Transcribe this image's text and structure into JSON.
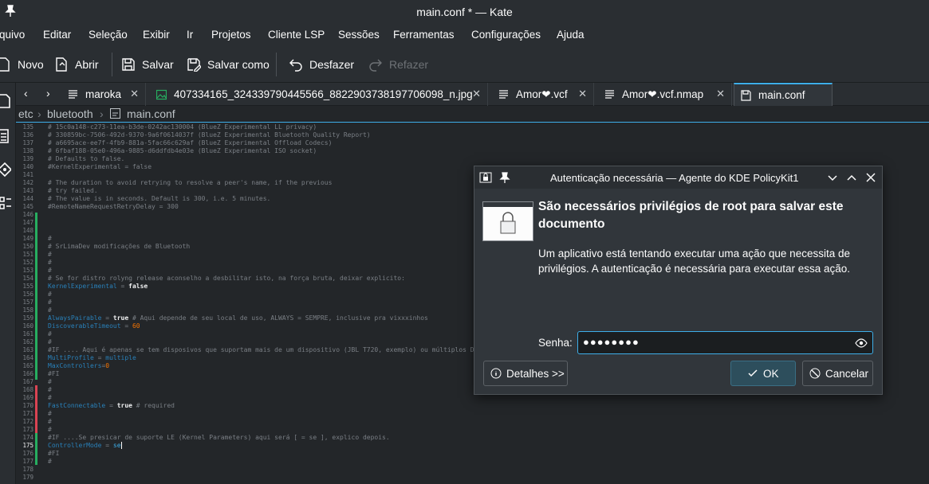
{
  "window": {
    "title": "main.conf * — Kate"
  },
  "menu": [
    "quivo",
    "Editar",
    "Seleção",
    "Exibir",
    "Ir",
    "Projetos",
    "Cliente LSP",
    "Sessões",
    "Ferramentas",
    "Configurações",
    "Ajuda"
  ],
  "toolbar": {
    "new_label": "Novo",
    "open_label": "Abrir",
    "save_label": "Salvar",
    "saveas_label": "Salvar como",
    "undo_label": "Desfazer",
    "redo_label": "Refazer"
  },
  "tabs": [
    {
      "label": "maroka"
    },
    {
      "label": "407334165_324339790445566_8822903738197706098_n.jpg"
    },
    {
      "label": "Amor❤.vcf"
    },
    {
      "label": "Amor❤.vcf.nmap"
    },
    {
      "label": "main.conf"
    }
  ],
  "breadcrumb": {
    "p1": "etc",
    "p2": "bluetooth",
    "p3": "main.conf"
  },
  "editor": {
    "line_numbers": [
      "135",
      "136",
      "137",
      "138",
      "139",
      "140",
      "141",
      "142",
      "143",
      "144",
      "145",
      "146",
      "147",
      "148",
      "149",
      "150",
      "151",
      "152",
      "153",
      "154",
      "155",
      "156",
      "157",
      "158",
      "159",
      "160",
      "161",
      "162",
      "163",
      "164",
      "165",
      "166",
      "167",
      "168",
      "169",
      "170",
      "171",
      "172",
      "173",
      "174",
      "175",
      "176",
      "177",
      "178",
      "179"
    ],
    "current_line": "175",
    "lines": {
      "l135": "# 15c0a148-c273-11ea-b3de-0242ac130004 (BlueZ Experimental LL privacy)",
      "l136": "# 330859bc-7506-492d-9370-9a6f0614037f (BlueZ Experimental Bluetooth Quality Report)",
      "l137": "# a6695ace-ee7f-4fb9-881a-5fac66c629af (BlueZ Experimental Offload Codecs)",
      "l138": "# 6fbaf188-05e0-496a-9885-d6ddfdb4e03e (BlueZ Experimental ISO socket)",
      "l139": "# Defaults to false.",
      "l140": "#KernelExperimental = false",
      "l142": "# The duration to avoid retrying to resolve a peer's name, if the previous",
      "l143": "# try failed.",
      "l144": "# The value is in seconds. Default is 300, i.e. 5 minutes.",
      "l145": "#RemoteNameRequestRetryDelay = 300",
      "l149": "#",
      "l150": "# SrLimaDev modificações de Bluetooth",
      "l151": "#",
      "l152": "#",
      "l153": "#",
      "l154": "# Se for distro rolyng release aconselho a desbilitar isto, na força bruta, deixar explicito:",
      "l155_key": "KernelExperimental",
      "l155_op": " = ",
      "l155_val": "false",
      "l156": "#",
      "l157": "#",
      "l158": "#",
      "l159_key": "AlwaysPairable",
      "l159_op": " = ",
      "l159_val": "true",
      "l159_cmt": " # Aqui depende de seu local de uso, ALWAYS = SEMPRE, inclusive pra vixxxinhos",
      "l160_key": "DiscoverableTimeout",
      "l160_op": " = ",
      "l160_val": "60",
      "l161": "#",
      "l162": "#",
      "l163": "#IF .... Aqui é apenas se tem disposivos que suportam mais de um dispositivo (JBL T720, exemplo) ou múltiplos D",
      "l164_key": "MultiProfile",
      "l164_op": " = ",
      "l164_val": "multiple",
      "l165_key": "MaxControllers",
      "l165_op": "=",
      "l165_val": "0",
      "l166": "#FI",
      "l167": "#",
      "l168": "#",
      "l169": "#",
      "l170_key": "FastConnectable",
      "l170_op": " = ",
      "l170_val": "true",
      "l170_cmt": " # required",
      "l171": "#",
      "l172": "#",
      "l173": "#",
      "l174": "#IF ....Se presicar de suporte LE (Kernel Parameters) aqui será [ = se ], explico depois.",
      "l175_key": "ControllerMode",
      "l175_op": " = ",
      "l175_val": "se",
      "l176": "#FI",
      "l177": "#"
    }
  },
  "dialog": {
    "title": "Autenticação necessária — Agente do KDE PolicyKit1",
    "heading": "São necessários privilégios de root para salvar este documento",
    "body": "Um aplicativo está tentando executar uma ação que necessita de privilégios. A autenticação é necessária para executar essa ação.",
    "password_label": "Senha:",
    "password_mask": "●●●●●●●●",
    "details_label": "Detalhes >>",
    "ok_label": "OK",
    "cancel_label": "Cancelar"
  },
  "colors": {
    "accent": "#3daee9",
    "bg": "#232629",
    "panel": "#2a2e32",
    "keyword": "#2980b9",
    "number": "#f67400",
    "modified_line": "#27ae60",
    "saved_line": "#da4453"
  }
}
